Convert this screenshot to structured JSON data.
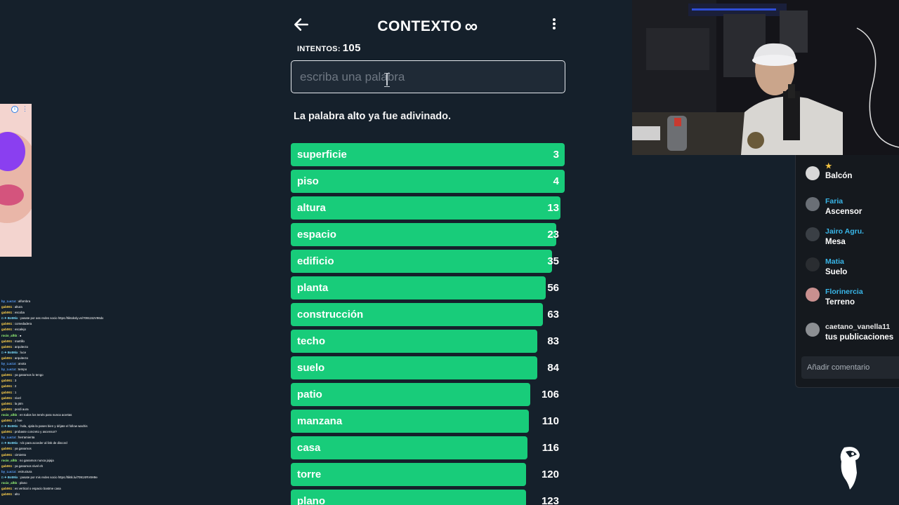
{
  "header": {
    "title": "CONTEXTO",
    "title_symbol": "∞",
    "back_icon": "arrow-left-icon",
    "menu_icon": "kebab-menu-icon"
  },
  "attempts": {
    "label": "INTENTOS:",
    "value": "105"
  },
  "search": {
    "placeholder": "escriba una palabra",
    "value": ""
  },
  "message": {
    "prefix": "La palabra",
    "word": "alto",
    "suffix": "ya fue adivinado."
  },
  "guesses": [
    {
      "word": "superficie",
      "rank": "3",
      "closeness": 1.0
    },
    {
      "word": "piso",
      "rank": "4",
      "closeness": 1.0
    },
    {
      "word": "altura",
      "rank": "13",
      "closeness": 0.985
    },
    {
      "word": "espacio",
      "rank": "23",
      "closeness": 0.97
    },
    {
      "word": "edificio",
      "rank": "35",
      "closeness": 0.955
    },
    {
      "word": "planta",
      "rank": "56",
      "closeness": 0.93
    },
    {
      "word": "construcción",
      "rank": "63",
      "closeness": 0.92
    },
    {
      "word": "techo",
      "rank": "83",
      "closeness": 0.9
    },
    {
      "word": "suelo",
      "rank": "84",
      "closeness": 0.9
    },
    {
      "word": "patio",
      "rank": "106",
      "closeness": 0.875
    },
    {
      "word": "manzana",
      "rank": "110",
      "closeness": 0.87
    },
    {
      "word": "casa",
      "rank": "116",
      "closeness": 0.865
    },
    {
      "word": "torre",
      "rank": "120",
      "closeness": 0.86
    },
    {
      "word": "plano",
      "rank": "123",
      "closeness": 0.86
    }
  ],
  "colors": {
    "background": "#15202b",
    "bar_green": "#18cc7a",
    "input_bg": "#1f2a36",
    "ig_username": "#39b6e8"
  },
  "twitch_chat": [
    {
      "user": "by_Luc14",
      "text": "alfombra",
      "color": "#5ea3ff"
    },
    {
      "user": "gab061",
      "text": "altura",
      "color": "#ffd24d"
    },
    {
      "user": "gab061",
      "text": "escoba",
      "color": "#ffd24d"
    },
    {
      "user": "◘ ✦ BotMix",
      "text": "pasate por ass redes socio https://tiktoksly.vs/7091152V96dx",
      "color": "#7fe0ff"
    },
    {
      "user": "gab061",
      "text": "comedadera",
      "color": "#ffd24d"
    },
    {
      "user": "gab061",
      "text": "escalejo",
      "color": "#ffd24d"
    },
    {
      "user": "rocio_alhb",
      "text": "●",
      "color": "#9dff7a"
    },
    {
      "user": "gab061",
      "text": "martillo",
      "color": "#ffd24d"
    },
    {
      "user": "gab061",
      "text": "arquitecto",
      "color": "#ffd24d"
    },
    {
      "user": "◘ ✦ BotMix",
      "text": "luce",
      "color": "#7fe0ff"
    },
    {
      "user": "gab061",
      "text": "arquitecto",
      "color": "#ffd24d"
    },
    {
      "user": "by_Luc14",
      "text": "anota",
      "color": "#5ea3ff"
    },
    {
      "user": "by_Luc14",
      "text": "tempo",
      "color": "#5ea3ff"
    },
    {
      "user": "gab061",
      "text": "ya ganamos lo tengo",
      "color": "#ffd24d"
    },
    {
      "user": "gab061",
      "text": "3",
      "color": "#ffd24d"
    },
    {
      "user": "gab061",
      "text": "2",
      "color": "#ffd24d"
    },
    {
      "user": "gab061",
      "text": "1",
      "color": "#ffd24d"
    },
    {
      "user": "gab061",
      "text": "nivel",
      "color": "#ffd24d"
    },
    {
      "user": "gab061",
      "text": "la ptm",
      "color": "#ffd24d"
    },
    {
      "user": "gab061",
      "text": "perdi aura",
      "color": "#ffd24d"
    },
    {
      "user": "rocio_alhb",
      "text": "en todos los tenés para nunca acertas",
      "color": "#9dff7a"
    },
    {
      "user": "gab061",
      "text": "y hoe",
      "color": "#ffd24d"
    },
    {
      "user": "◘ ✦ BotMix",
      "text": "hola, ojala la pases bien y déjate el follow wachis",
      "color": "#7fe0ff"
    },
    {
      "user": "gab061",
      "text": "probaste concreto y ascensor?",
      "color": "#ffd24d"
    },
    {
      "user": "by_Luc14",
      "text": "herramienta",
      "color": "#5ea3ff"
    },
    {
      "user": "◘ ✦ BotMix",
      "text": "!dc para acceder al link de discord",
      "color": "#7fe0ff"
    },
    {
      "user": "gab061",
      "text": "ya ganamos",
      "color": "#ffd24d"
    },
    {
      "user": "gab061",
      "text": "cimiento",
      "color": "#ffd24d"
    },
    {
      "user": "rocio_alhb",
      "text": "no ganamos nunca jajaja",
      "color": "#9dff7a"
    },
    {
      "user": "gab061",
      "text": "ya ganamos nivel eh",
      "color": "#ffd24d"
    },
    {
      "user": "by_Luc14",
      "text": "estructura",
      "color": "#5ea3ff"
    },
    {
      "user": "◘ ✦ BotMix",
      "text": "pasate por mis redes socio https://tiktk.lu/7091XRV8H9e",
      "color": "#7fe0ff"
    },
    {
      "user": "rocio_alhb",
      "text": "plano",
      "color": "#9dff7a"
    },
    {
      "user": "gab061",
      "text": "es vertical o espacio bastme casa",
      "color": "#ffd24d"
    },
    {
      "user": "gab061",
      "text": "alto",
      "color": "#ffd24d"
    }
  ],
  "ad": {
    "info_icon": "info-icon",
    "more_icon": "kebab-menu-icon"
  },
  "webcam": {
    "description_icon": "webcam-feed"
  },
  "instagram": {
    "comments": [
      {
        "user": "★",
        "comment": "Balcón",
        "avatar_color": "#d8d8d8"
      },
      {
        "user": "Faria",
        "comment": "Ascensor",
        "avatar_color": "#6a6f76"
      },
      {
        "user": "Jairo Agru.",
        "comment": "Mesa",
        "avatar_color": "#3a3f45"
      },
      {
        "user": "Matia",
        "comment": "Suelo",
        "avatar_color": "#2a2d31"
      },
      {
        "user": "Florinercia",
        "comment": "Terreno",
        "avatar_color": "#c9908f"
      },
      {
        "user": "caetano_vanella11",
        "comment": "tus publicaciones",
        "avatar_color": "#8c8f93"
      }
    ],
    "add_comment_placeholder": "Añadir comentario"
  },
  "logo": {
    "icon": "toucan-logo-icon"
  }
}
